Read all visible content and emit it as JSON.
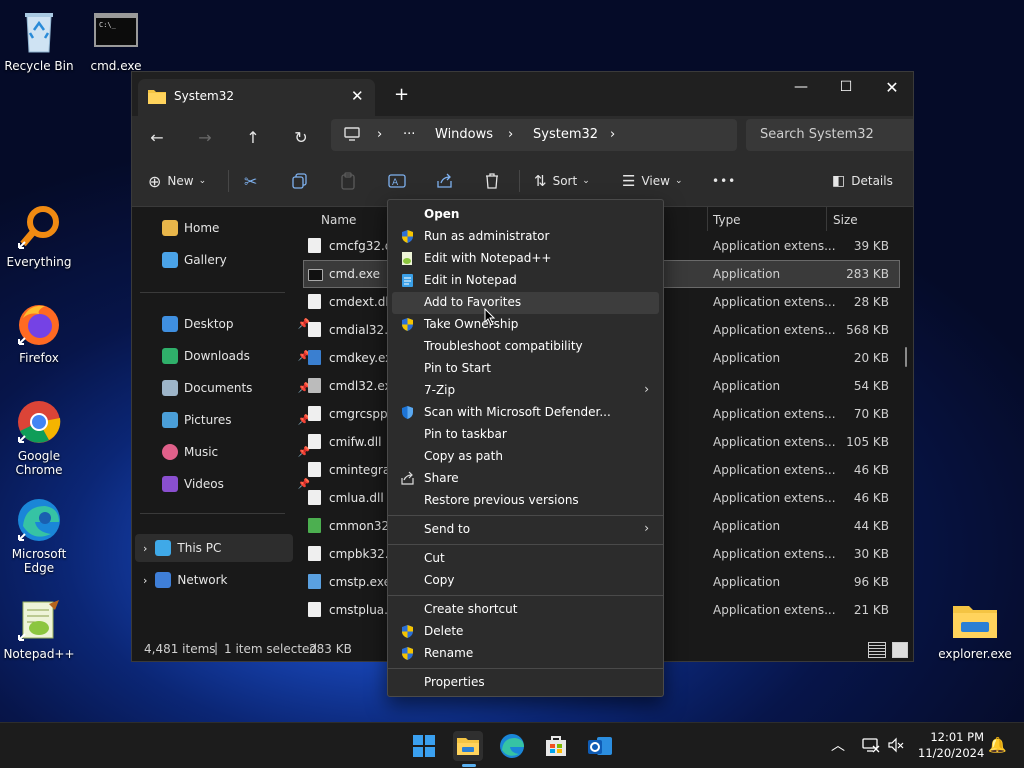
{
  "desktop": {
    "icons": [
      {
        "label": "Recycle Bin"
      },
      {
        "label": "cmd.exe"
      },
      {
        "label": "Everything"
      },
      {
        "label": "Firefox"
      },
      {
        "label": "Google Chrome"
      },
      {
        "label": "Microsoft Edge"
      },
      {
        "label": "Notepad++"
      },
      {
        "label": "explorer.exe"
      }
    ]
  },
  "window": {
    "tab_title": "System32",
    "address": {
      "ellipsis": "···",
      "segments": [
        "Windows",
        "System32"
      ]
    },
    "search_placeholder": "Search System32",
    "toolbar": {
      "new_label": "New",
      "sort_label": "Sort",
      "view_label": "View",
      "more_label": "•••",
      "details_label": "Details"
    },
    "nav": {
      "home": "Home",
      "gallery": "Gallery",
      "quick": [
        "Desktop",
        "Downloads",
        "Documents",
        "Pictures",
        "Music",
        "Videos"
      ],
      "this_pc": "This PC",
      "network": "Network"
    },
    "columns": {
      "name": "Name",
      "type": "Type",
      "size": "Size"
    },
    "files": [
      {
        "name": "cmcfg32.dll",
        "type": "Application extens...",
        "size": "39 KB"
      },
      {
        "name": "cmd.exe",
        "type": "Application",
        "size": "283 KB"
      },
      {
        "name": "cmdext.dll",
        "type": "Application extens...",
        "size": "28 KB"
      },
      {
        "name": "cmdial32.d",
        "type": "Application extens...",
        "size": "568 KB"
      },
      {
        "name": "cmdkey.exe",
        "type": "Application",
        "size": "20 KB"
      },
      {
        "name": "cmdl32.exe",
        "type": "Application",
        "size": "54 KB"
      },
      {
        "name": "cmgrcspps",
        "type": "Application extens...",
        "size": "70 KB"
      },
      {
        "name": "cmifw.dll",
        "type": "Application extens...",
        "size": "105 KB"
      },
      {
        "name": "cmintegrat",
        "type": "Application extens...",
        "size": "46 KB"
      },
      {
        "name": "cmlua.dll",
        "type": "Application extens...",
        "size": "46 KB"
      },
      {
        "name": "cmmon32.e",
        "type": "Application",
        "size": "44 KB"
      },
      {
        "name": "cmpbk32.d",
        "type": "Application extens...",
        "size": "30 KB"
      },
      {
        "name": "cmstp.exe",
        "type": "Application",
        "size": "96 KB"
      },
      {
        "name": "cmstplua.d",
        "type": "Application extens...",
        "size": "21 KB"
      }
    ],
    "status": {
      "items": "4,481 items",
      "selected": "1 item selected",
      "size": "283 KB"
    }
  },
  "context_menu": {
    "open": "Open",
    "run_as_admin": "Run as administrator",
    "edit_npp": "Edit with Notepad++",
    "edit_notepad": "Edit in Notepad",
    "add_favorites": "Add to Favorites",
    "take_ownership": "Take Ownership",
    "troubleshoot": "Troubleshoot compatibility",
    "pin_start": "Pin to Start",
    "zip": "7-Zip",
    "scan_defender": "Scan with Microsoft Defender...",
    "pin_taskbar": "Pin to taskbar",
    "copy_path": "Copy as path",
    "share": "Share",
    "restore": "Restore previous versions",
    "send_to": "Send to",
    "cut": "Cut",
    "copy": "Copy",
    "create_shortcut": "Create shortcut",
    "delete": "Delete",
    "rename": "Rename",
    "properties": "Properties"
  },
  "taskbar": {
    "time": "12:01 PM",
    "date": "11/20/2024"
  },
  "colors": {
    "accent": "#0078d4",
    "folder": "#f4c443",
    "uac_blue": "#2b6fd6",
    "uac_yellow": "#f5c400"
  }
}
